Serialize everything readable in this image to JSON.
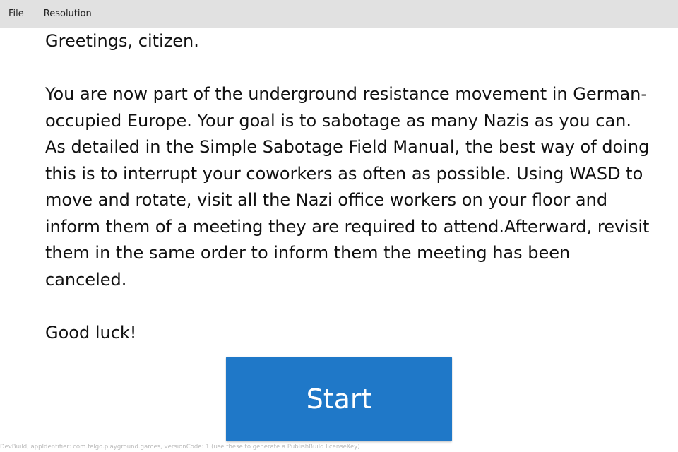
{
  "menubar": {
    "file_label": "File",
    "resolution_label": "Resolution"
  },
  "intro": {
    "greeting": "Greetings, citizen.",
    "body": "You are now part of the underground resistance movement in German-occupied Europe. Your goal is to sabotage as many Nazis as you can. As detailed in the Simple Sabotage Field Manual, the best way of doing this is to interrupt your coworkers as often as possible. Using WASD to move and rotate, visit all the Nazi office workers on your floor and inform them of a meeting they are required to attend.Afterward, revisit them in the same order to inform them the meeting has been canceled.",
    "closing": "Good luck!"
  },
  "start_button": {
    "label": "Start",
    "color": "#1f78c8"
  },
  "footer": {
    "build_note": "DevBuild, appIdentifier: com.felgo.playground.games, versionCode: 1 (use these to generate a PublishBuild licenseKey)"
  }
}
